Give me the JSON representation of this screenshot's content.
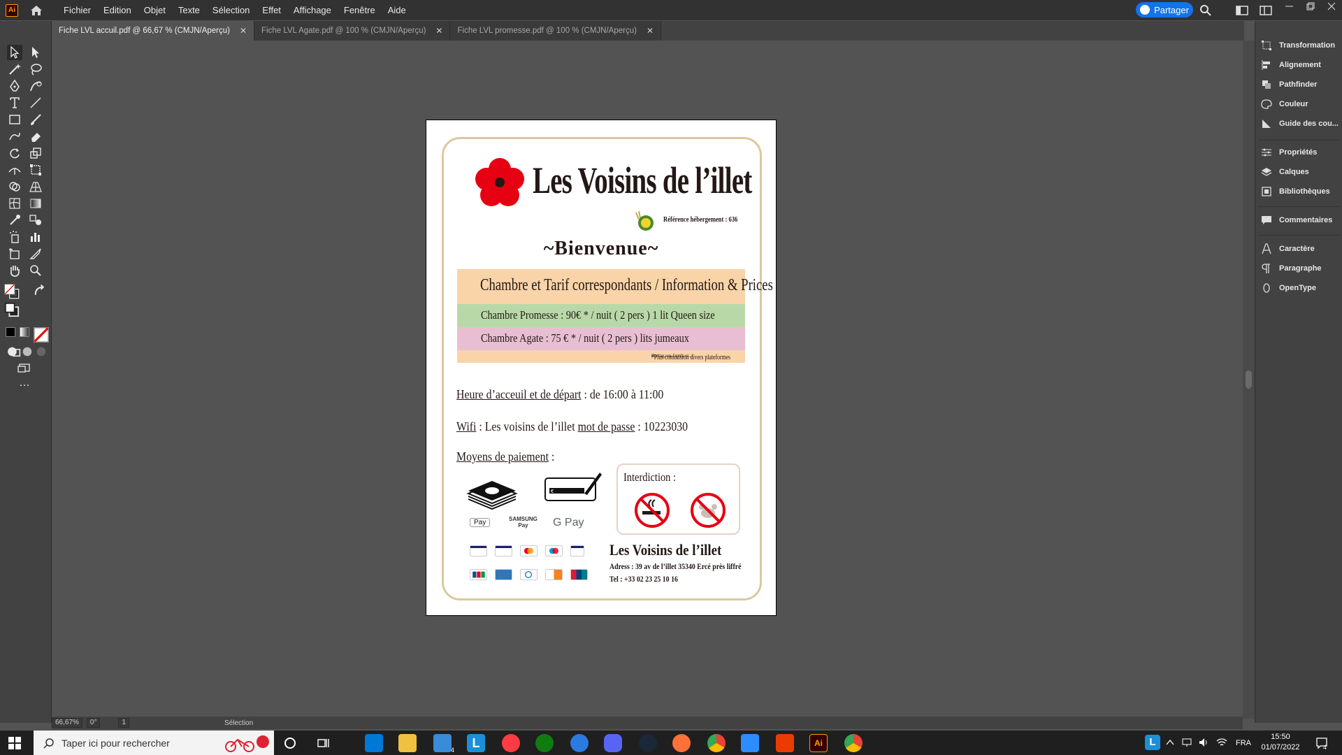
{
  "app": {
    "logo": "Ai",
    "menus": [
      "Fichier",
      "Edition",
      "Objet",
      "Texte",
      "Sélection",
      "Effet",
      "Affichage",
      "Fenêtre",
      "Aide"
    ],
    "share_label": "Partager"
  },
  "tabs": [
    {
      "label": "Fiche LVL accuil.pdf @ 66,67 % (CMJN/Aperçu)",
      "active": true
    },
    {
      "label": "Fiche LVL Agate.pdf @ 100 % (CMJN/Aperçu)",
      "active": false
    },
    {
      "label": "Fiche LVL promesse.pdf @ 100 % (CMJN/Aperçu)",
      "active": false
    }
  ],
  "right_panel": {
    "group1": [
      "Transformation",
      "Alignement",
      "Pathfinder",
      "Couleur",
      "Guide des cou..."
    ],
    "group2": [
      "Propriétés",
      "Calques",
      "Bibliothèques"
    ],
    "group3": [
      "Commentaires"
    ],
    "group4": [
      "Caractère",
      "Paragraphe",
      "OpenType"
    ]
  },
  "document": {
    "brand": "Les Voisins de l’illet",
    "reference": "Référence hébergement : 636",
    "welcome": "~Bienvenue~",
    "table_title": "Chambre et Tarif correspondants / Information & Prices",
    "row_promesse": "Chambre Promesse : 90€ * / nuit ( 2 pers )  1 lit  Queen size",
    "row_agate": "Chambre Agate      : 75 € * / nuit ( 2 pers )  lits jumeaux",
    "note_main": "*Plus commision divers plateformes",
    "note_small": "(Booking.com, Expedia etc...)",
    "hours_label": "Heure d’acceuil et de départ",
    "hours_value": " :  de 16:00 à 11:00",
    "wifi_label": "Wifi",
    "wifi_value": " : Les voisins de l’illet    ",
    "password_label": "mot de passe",
    "password_value": " : 10223030",
    "payment_label": "Moyens de paiement",
    "payment_suffix": " :",
    "pay_apple": "Pay",
    "pay_samsung": "SAMSUNG",
    "pay_samsung2": "Pay",
    "pay_google": "G Pay",
    "interdiction_label": "Interdiction :",
    "footer_name": "Les Voisins de l’illet",
    "footer_address": "Adress : 39 av de l’illet 35340 Ercé près liffré",
    "footer_tel": "Tel : +33 02 23 25 10 16"
  },
  "status": {
    "zoom": "66,67%",
    "rotation": "0°",
    "page": "1",
    "tool": "Sélection"
  },
  "taskbar": {
    "search_placeholder": "Taper ici pour rechercher",
    "lang": "FRA",
    "time": "15:50",
    "date": "01/07/2022",
    "notif": "4",
    "mail_badge": "4"
  }
}
